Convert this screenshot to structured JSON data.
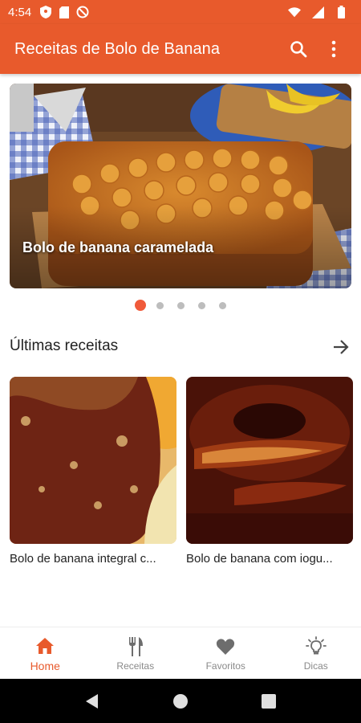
{
  "status_bar": {
    "time": "4:54",
    "icons": [
      "shield-icon",
      "sd-card-icon",
      "blocked-icon",
      "wifi-icon",
      "signal-icon",
      "battery-icon"
    ]
  },
  "app_bar": {
    "title": "Receitas de Bolo de Banana",
    "actions": [
      "search-icon",
      "more-vert-icon"
    ],
    "color": "#e85a2c"
  },
  "carousel": {
    "caption": "Bolo de banana caramelada",
    "page_count": 5,
    "active_index": 0,
    "active_color": "#f05a3a"
  },
  "latest": {
    "title": "Últimas receitas",
    "items": [
      {
        "label": "Bolo de banana integral c..."
      },
      {
        "label": "Bolo de banana com iogu..."
      }
    ]
  },
  "bottom_nav": {
    "items": [
      {
        "label": "Home",
        "icon": "home-icon",
        "active": true
      },
      {
        "label": "Receitas",
        "icon": "fork-knife-icon",
        "active": false
      },
      {
        "label": "Favoritos",
        "icon": "heart-icon",
        "active": false
      },
      {
        "label": "Dicas",
        "icon": "lightbulb-icon",
        "active": false
      }
    ],
    "active_color": "#e85a2c",
    "inactive_color": "#8a8a8a"
  },
  "system_nav": [
    "back-icon",
    "home-circle-icon",
    "recents-icon"
  ]
}
